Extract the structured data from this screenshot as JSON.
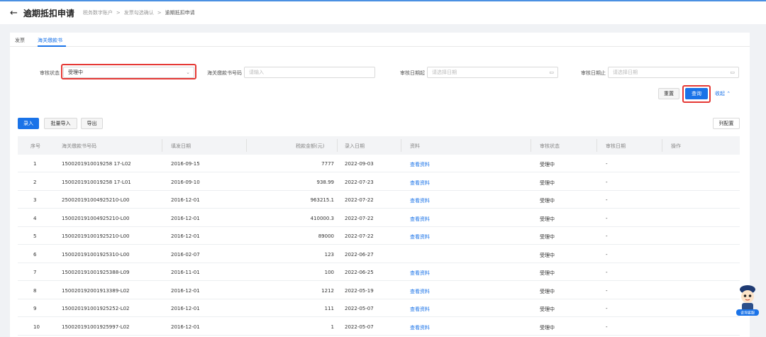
{
  "header": {
    "back_icon": "arrow-left-icon",
    "title": "逾期抵扣申请",
    "breadcrumbs": [
      "税务数字账户",
      "发票勾选确认",
      "逾期抵扣申请"
    ]
  },
  "tabs": [
    {
      "label": "发票"
    },
    {
      "label": "海关缴款书"
    }
  ],
  "filters": {
    "status_label": "审核状态",
    "status_value": "受理中",
    "customs_no_label": "海关缴款书号码",
    "customs_no_placeholder": "请输入",
    "audit_start_label": "审核日期起",
    "audit_start_placeholder": "请选择日期",
    "audit_end_label": "审核日期止",
    "audit_end_placeholder": "请选择日期"
  },
  "actions": {
    "reset": "重置",
    "query": "查询",
    "collapse": "收起",
    "entry": "录入",
    "batch_import": "批量导入",
    "export": "导出",
    "column_settings": "列配置"
  },
  "table": {
    "columns": [
      "序号",
      "海关缴款书号码",
      "填发日期",
      "税款金额(元)",
      "录入日期",
      "资料",
      "审核状态",
      "审核日期",
      "操作"
    ],
    "rows": [
      {
        "no": "1",
        "code": "1500201910019258 17-L02",
        "fill_date": "2016-09-15",
        "amount": "7777",
        "entry_date": "2022-09-03",
        "doc": "查看资料",
        "status": "受理中",
        "audit_date": "-"
      },
      {
        "no": "2",
        "code": "1500201910019258 17-L01",
        "fill_date": "2016-09-10",
        "amount": "938.99",
        "entry_date": "2022-07-23",
        "doc": "查看资料",
        "status": "受理中",
        "audit_date": "-"
      },
      {
        "no": "3",
        "code": "250020191004925210-L00",
        "fill_date": "2016-12-01",
        "amount": "963215.1",
        "entry_date": "2022-07-22",
        "doc": "查看资料",
        "status": "受理中",
        "audit_date": "-"
      },
      {
        "no": "4",
        "code": "150020191004925210-L00",
        "fill_date": "2016-12-01",
        "amount": "410000.3",
        "entry_date": "2022-07-22",
        "doc": "查看资料",
        "status": "受理中",
        "audit_date": "-"
      },
      {
        "no": "5",
        "code": "150020191001925210-L00",
        "fill_date": "2016-12-01",
        "amount": "89000",
        "entry_date": "2022-07-22",
        "doc": "查看资料",
        "status": "受理中",
        "audit_date": "-"
      },
      {
        "no": "6",
        "code": "150020191001925310-L00",
        "fill_date": "2016-02-07",
        "amount": "123",
        "entry_date": "2022-06-27",
        "doc": "",
        "status": "受理中",
        "audit_date": "-"
      },
      {
        "no": "7",
        "code": "150020191001925388-L09",
        "fill_date": "2016-11-01",
        "amount": "100",
        "entry_date": "2022-06-25",
        "doc": "查看资料",
        "status": "受理中",
        "audit_date": "-"
      },
      {
        "no": "8",
        "code": "150020192001913389-L02",
        "fill_date": "2016-12-01",
        "amount": "1212",
        "entry_date": "2022-05-19",
        "doc": "查看资料",
        "status": "受理中",
        "audit_date": "-"
      },
      {
        "no": "9",
        "code": "150020191001925252-L02",
        "fill_date": "2016-12-01",
        "amount": "111",
        "entry_date": "2022-05-07",
        "doc": "查看资料",
        "status": "受理中",
        "audit_date": "-"
      },
      {
        "no": "10",
        "code": "150020191001925997-L02",
        "fill_date": "2016-12-01",
        "amount": "1",
        "entry_date": "2022-05-07",
        "doc": "查看资料",
        "status": "受理中",
        "audit_date": "-"
      }
    ]
  },
  "mascot": {
    "label": "咨询客服"
  },
  "colors": {
    "primary": "#1a73e8",
    "highlight": "#e53935",
    "background": "#f0f2f5"
  }
}
